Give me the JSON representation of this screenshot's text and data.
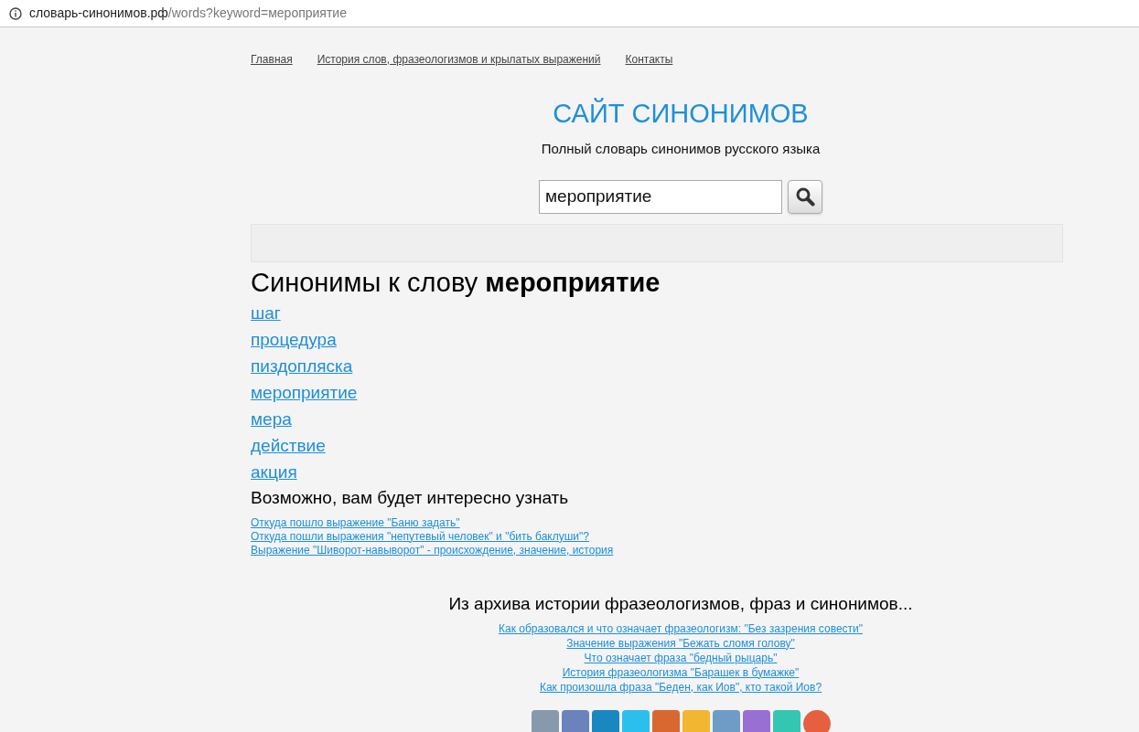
{
  "address_bar": {
    "domain": "словарь-синонимов.рф",
    "path": "/words?keyword=мероприятие"
  },
  "nav": [
    "Главная",
    "История слов, фразеологизмов и крылатых выражений",
    "Контакты"
  ],
  "site_title": "САЙТ СИНОНИМОВ",
  "subtitle": "Полный словарь синонимов русского языка",
  "search": {
    "value": "мероприятие"
  },
  "heading": "Синонимы к слову **мероприятие**",
  "synonyms": [
    "шаг",
    "процедура",
    "пиздопляска",
    "мероприятие",
    "мера",
    "действие",
    "акция"
  ],
  "related_heading": "Возможно, вам будет интересно узнать",
  "related_links": [
    "Откуда пошло выражение \"Баню задать\"",
    "Откуда пошли выражения \"непутевый человек\" и \"бить баклуши\"?",
    "Выражение \"Шиворот-навыворот\" - происхождение, значение, история"
  ],
  "archive_heading": "Из архива истории фразеологизмов, фраз и синонимов...",
  "archive_links": [
    "Как образовался и что означает фразеологизм: \"Без зазрения совести\"",
    "Значение выражения \"Бежать сломя голову\"",
    "Что означает фраза \"бедный рыцарь\"",
    "История фразеологизма \"Барашек в бумажке\"",
    "Как произошла фраза \"Беден, как Иов\", кто такой Иов?"
  ],
  "share_buttons": [
    {
      "color": "#8799ad"
    },
    {
      "color": "#6a83bd"
    },
    {
      "color": "#1a88c0"
    },
    {
      "color": "#2bbfee"
    },
    {
      "color": "#d8682f"
    },
    {
      "color": "#f3b631"
    },
    {
      "color": "#6f9bc7"
    },
    {
      "color": "#9a6fd3"
    },
    {
      "color": "#33c6b0"
    },
    {
      "color": "#e4603f",
      "kind": "round"
    }
  ]
}
